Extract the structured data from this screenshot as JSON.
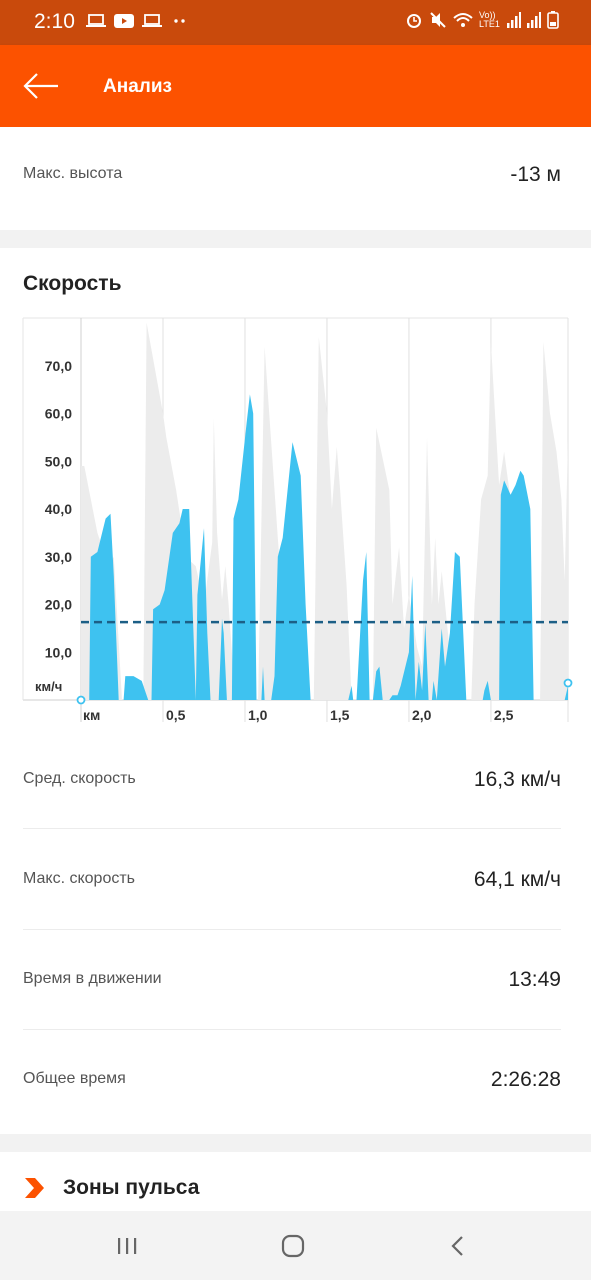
{
  "status_bar": {
    "time": "2:10",
    "icons_left": [
      "laptop-icon",
      "youtube-icon",
      "laptop-icon",
      "more-dots-icon"
    ],
    "icons_right": [
      "alarm-icon",
      "mute-icon",
      "wifi-icon",
      "volte-icon",
      "signal-icon",
      "signal-icon",
      "battery-icon"
    ],
    "network_label": "Vo)) LTE1"
  },
  "app_bar": {
    "title": "Анализ",
    "back_icon": "arrow-left-icon",
    "color": "#fc5200"
  },
  "elevation": {
    "label": "Макс. высота",
    "value": "-13 м"
  },
  "speed": {
    "title": "Скорость",
    "stats": [
      {
        "label": "Сред. скорость",
        "value": "16,3 км/ч"
      },
      {
        "label": "Макс. скорость",
        "value": "64,1 км/ч"
      },
      {
        "label": "Время в движении",
        "value": "13:49"
      },
      {
        "label": "Общее время",
        "value": "2:26:28"
      }
    ]
  },
  "chart_data": {
    "type": "area",
    "ylabel": "км/ч",
    "xlabel": "км",
    "y_ticks": [
      "10,0",
      "20,0",
      "30,0",
      "40,0",
      "50,0",
      "60,0",
      "70,0"
    ],
    "x_ticks": [
      "0,5",
      "1,0",
      "1,5",
      "2,0",
      "2,5"
    ],
    "ylim": [
      0,
      80
    ],
    "xlim": [
      0,
      2.97
    ],
    "average_line": 16.3,
    "colors": {
      "speed": "#3ec2f0",
      "elevation": "#ececec",
      "average": "#1c5f86"
    },
    "series": [
      {
        "values_label": "speed",
        "points": [
          [
            0,
            0
          ],
          [
            0.05,
            0
          ],
          [
            0.06,
            30
          ],
          [
            0.1,
            31
          ],
          [
            0.15,
            38
          ],
          [
            0.18,
            39
          ],
          [
            0.2,
            26
          ],
          [
            0.23,
            0
          ],
          [
            0.26,
            0
          ],
          [
            0.27,
            5
          ],
          [
            0.32,
            5
          ],
          [
            0.37,
            4
          ],
          [
            0.41,
            0
          ],
          [
            0.43,
            0
          ],
          [
            0.44,
            19
          ],
          [
            0.48,
            20
          ],
          [
            0.51,
            23
          ],
          [
            0.56,
            35
          ],
          [
            0.6,
            37
          ],
          [
            0.62,
            40
          ],
          [
            0.66,
            40
          ],
          [
            0.68,
            20
          ],
          [
            0.7,
            0
          ],
          [
            0.71,
            22
          ],
          [
            0.75,
            36
          ],
          [
            0.77,
            14
          ],
          [
            0.79,
            0
          ],
          [
            0.84,
            0
          ],
          [
            0.86,
            17
          ],
          [
            0.87,
            14
          ],
          [
            0.89,
            0
          ],
          [
            0.92,
            0
          ],
          [
            0.93,
            38
          ],
          [
            0.96,
            42
          ],
          [
            1.01,
            58
          ],
          [
            1.03,
            64
          ],
          [
            1.05,
            60
          ],
          [
            1.07,
            0
          ],
          [
            1.1,
            0
          ],
          [
            1.11,
            7
          ],
          [
            1.12,
            0
          ],
          [
            1.16,
            0
          ],
          [
            1.18,
            5
          ],
          [
            1.2,
            30
          ],
          [
            1.23,
            34
          ],
          [
            1.29,
            54
          ],
          [
            1.34,
            47
          ],
          [
            1.37,
            20
          ],
          [
            1.4,
            0
          ],
          [
            1.63,
            0
          ],
          [
            1.65,
            3
          ],
          [
            1.66,
            0
          ],
          [
            1.67,
            0
          ],
          [
            1.68,
            0
          ],
          [
            1.72,
            25
          ],
          [
            1.74,
            31
          ],
          [
            1.76,
            0
          ],
          [
            1.78,
            0
          ],
          [
            1.8,
            6
          ],
          [
            1.82,
            7
          ],
          [
            1.84,
            0
          ],
          [
            1.88,
            0
          ],
          [
            1.9,
            1
          ],
          [
            1.93,
            1
          ],
          [
            1.95,
            3
          ],
          [
            2.0,
            10
          ],
          [
            2.02,
            26
          ],
          [
            2.04,
            0
          ],
          [
            2.06,
            8
          ],
          [
            2.08,
            2
          ],
          [
            2.1,
            16
          ],
          [
            2.12,
            0
          ],
          [
            2.14,
            0
          ],
          [
            2.15,
            4
          ],
          [
            2.17,
            0
          ],
          [
            2.2,
            15
          ],
          [
            2.22,
            7
          ],
          [
            2.25,
            14
          ],
          [
            2.28,
            31
          ],
          [
            2.31,
            30
          ],
          [
            2.35,
            0
          ],
          [
            2.45,
            0
          ],
          [
            2.46,
            2
          ],
          [
            2.48,
            4
          ],
          [
            2.5,
            0
          ],
          [
            2.55,
            0
          ],
          [
            2.56,
            43
          ],
          [
            2.58,
            46
          ],
          [
            2.62,
            43
          ],
          [
            2.65,
            45
          ],
          [
            2.68,
            48
          ],
          [
            2.7,
            47
          ],
          [
            2.74,
            40
          ],
          [
            2.76,
            0
          ],
          [
            2.95,
            0
          ],
          [
            2.97,
            3
          ]
        ]
      },
      {
        "values_label": "elevation_background",
        "points": [
          [
            0,
            49
          ],
          [
            0.02,
            49
          ],
          [
            0.1,
            35
          ],
          [
            0.17,
            28
          ],
          [
            0.2,
            30
          ],
          [
            0.25,
            0
          ],
          [
            0.38,
            0
          ],
          [
            0.4,
            79
          ],
          [
            0.5,
            60
          ],
          [
            0.52,
            55
          ],
          [
            0.58,
            44
          ],
          [
            0.62,
            35
          ],
          [
            0.64,
            30
          ],
          [
            0.7,
            28
          ],
          [
            0.75,
            20
          ],
          [
            0.8,
            33
          ],
          [
            0.81,
            59
          ],
          [
            0.83,
            35
          ],
          [
            0.86,
            21
          ],
          [
            0.88,
            28
          ],
          [
            0.9,
            20
          ],
          [
            0.92,
            10
          ],
          [
            0.94,
            0
          ],
          [
            1.08,
            0
          ],
          [
            1.12,
            74
          ],
          [
            1.2,
            34
          ],
          [
            1.23,
            20
          ],
          [
            1.25,
            27
          ],
          [
            1.28,
            20
          ],
          [
            1.3,
            25
          ],
          [
            1.35,
            0
          ],
          [
            1.42,
            0
          ],
          [
            1.45,
            76
          ],
          [
            1.5,
            60
          ],
          [
            1.53,
            40
          ],
          [
            1.56,
            53
          ],
          [
            1.58,
            44
          ],
          [
            1.62,
            24
          ],
          [
            1.65,
            0
          ],
          [
            1.78,
            0
          ],
          [
            1.8,
            57
          ],
          [
            1.88,
            44
          ],
          [
            1.9,
            20
          ],
          [
            1.94,
            32
          ],
          [
            1.97,
            15
          ],
          [
            2.0,
            22
          ],
          [
            2.05,
            11
          ],
          [
            2.08,
            7
          ],
          [
            2.11,
            55
          ],
          [
            2.14,
            20
          ],
          [
            2.16,
            34
          ],
          [
            2.18,
            20
          ],
          [
            2.2,
            27
          ],
          [
            2.25,
            10
          ],
          [
            2.27,
            0
          ],
          [
            2.38,
            0
          ],
          [
            2.4,
            20
          ],
          [
            2.42,
            31
          ],
          [
            2.44,
            42
          ],
          [
            2.48,
            47
          ],
          [
            2.5,
            75
          ],
          [
            2.55,
            45
          ],
          [
            2.58,
            52
          ],
          [
            2.62,
            42
          ],
          [
            2.7,
            33
          ],
          [
            2.74,
            20
          ],
          [
            2.76,
            0
          ],
          [
            2.8,
            0
          ],
          [
            2.82,
            75
          ],
          [
            2.86,
            60
          ],
          [
            2.9,
            52
          ],
          [
            2.93,
            42
          ],
          [
            2.95,
            25
          ],
          [
            2.97,
            55
          ]
        ]
      }
    ]
  },
  "heart_zones": {
    "title": "Зоны пульса",
    "icon": "chevron-right-icon",
    "color": "#fc5200"
  },
  "nav_bar": {
    "buttons": [
      "recent-apps-icon",
      "home-icon",
      "back-icon"
    ]
  }
}
